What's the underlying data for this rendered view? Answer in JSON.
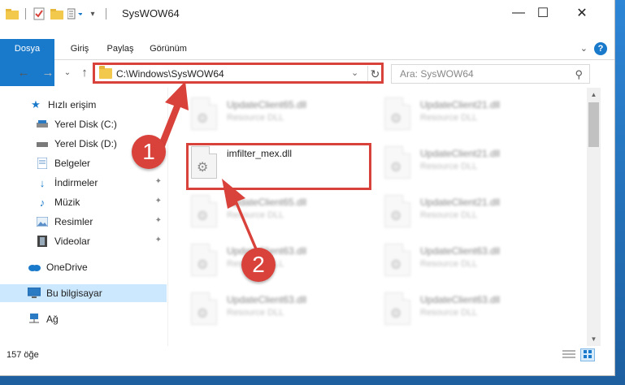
{
  "window": {
    "title": "SysWOW64",
    "minimize_symbol": "—",
    "maximize_symbol": "☐",
    "close_symbol": "✕"
  },
  "ribbon": {
    "tabs": [
      {
        "label": "Dosya"
      },
      {
        "label": "Giriş"
      },
      {
        "label": "Paylaş"
      },
      {
        "label": "Görünüm"
      }
    ],
    "help_symbol": "?",
    "collapse_symbol": "⌄",
    "accent_color": "#1979ca"
  },
  "navigation": {
    "back_symbol": "←",
    "forward_symbol": "→",
    "recent_symbol": "⌄",
    "up_symbol": "↑",
    "address": "C:\\Windows\\SysWOW64",
    "address_dropdown_symbol": "⌄",
    "refresh_symbol": "↻",
    "search_placeholder": "Ara: SysWOW64",
    "search_symbol": "⚲"
  },
  "sidebar": {
    "items": [
      {
        "label": "Hızlı erişim",
        "icon": "star-icon",
        "pinned": false
      },
      {
        "label": "Yerel Disk (C:)",
        "icon": "drive-icon",
        "pinned": false
      },
      {
        "label": "Yerel Disk (D:)",
        "icon": "drive-icon",
        "pinned": false
      },
      {
        "label": "Belgeler",
        "icon": "documents-icon",
        "pinned": true
      },
      {
        "label": "İndirmeler",
        "icon": "download-icon",
        "pinned": true
      },
      {
        "label": "Müzik",
        "icon": "music-icon",
        "pinned": true
      },
      {
        "label": "Resimler",
        "icon": "pictures-icon",
        "pinned": true
      },
      {
        "label": "Videolar",
        "icon": "video-icon",
        "pinned": true
      },
      {
        "label": "OneDrive",
        "icon": "cloud-icon",
        "pinned": false
      },
      {
        "label": "Bu bilgisayar",
        "icon": "computer-icon",
        "pinned": false,
        "selected": true
      },
      {
        "label": "Ağ",
        "icon": "network-icon",
        "pinned": false
      }
    ],
    "pin_symbol": "✦"
  },
  "files": {
    "highlighted": {
      "name": "imfilter_mex.dll",
      "type": ""
    },
    "blurred": [
      {
        "name": "UpdateClient65.dll",
        "type": "Resource DLL"
      },
      {
        "name": "UpdateClient21.dll",
        "type": "Resource DLL"
      },
      {
        "name": "UpdateClient65.dll",
        "type": "Resource DLL"
      },
      {
        "name": "UpdateClient21.dll",
        "type": "Resource DLL"
      },
      {
        "name": "UpdateClient21.dll",
        "type": "Resource DLL"
      },
      {
        "name": "UpdateClient63.dll",
        "type": "Resource DLL"
      },
      {
        "name": "UpdateClient63.dll",
        "type": "Resource DLL"
      },
      {
        "name": "UpdateClient63.dll",
        "type": "Resource DLL"
      },
      {
        "name": "UpdateClient63.dll",
        "type": "Resource DLL"
      }
    ]
  },
  "status": {
    "item_count": "157 öğe"
  },
  "annotations": {
    "step1": "1",
    "step2": "2",
    "color": "#d9413b"
  }
}
